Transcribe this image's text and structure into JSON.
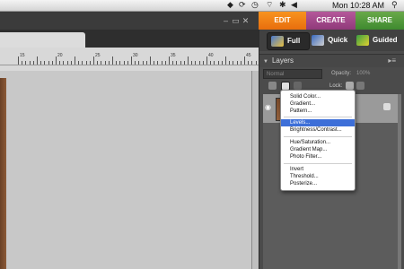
{
  "menubar": {
    "clock": "Mon 10:28 AM",
    "status_icons": [
      "dropbox-icon",
      "sync-icon",
      "time-machine-icon",
      "wifi-icon",
      "bluetooth-icon",
      "volume-icon",
      "spotlight-icon"
    ]
  },
  "mode_tabs": {
    "edit": "EDIT",
    "create": "CREATE",
    "share": "SHARE"
  },
  "edit_modes": {
    "full": "Full",
    "quick": "Quick",
    "guided": "Guided"
  },
  "layers_panel": {
    "title": "Layers",
    "blend_mode": "Normal",
    "opacity_label": "Opacity:",
    "opacity_value": "100%",
    "lock_label": "Lock:"
  },
  "ruler": {
    "labels": [
      "15",
      "20",
      "25",
      "30",
      "35",
      "40",
      "45"
    ]
  },
  "adjustment_menu": {
    "group1": [
      "Solid Color...",
      "Gradient...",
      "Pattern..."
    ],
    "group2": [
      "Levels...",
      "Brightness/Contrast..."
    ],
    "group3": [
      "Hue/Saturation...",
      "Gradient Map...",
      "Photo Filter..."
    ],
    "group4": [
      "Invert",
      "Threshold...",
      "Posterize..."
    ],
    "highlighted": "Levels..."
  },
  "colors": {
    "edit": "#f08020",
    "create": "#a04a8a",
    "share": "#5a9a3e",
    "highlight": "#3d6fd8"
  }
}
